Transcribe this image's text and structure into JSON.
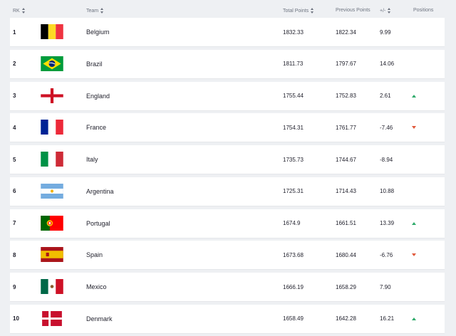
{
  "header": {
    "rank": "RK",
    "team": "Team",
    "total_points": "Total Points",
    "previous_points": "Previous Points",
    "diff": "+/-",
    "positions": "Positions"
  },
  "rows": [
    {
      "rank": "1",
      "team": "Belgium",
      "flag": "belgium-flag",
      "total": "1832.33",
      "previous": "1822.34",
      "diff": "9.99",
      "position": "none"
    },
    {
      "rank": "2",
      "team": "Brazil",
      "flag": "brazil-flag",
      "total": "1811.73",
      "previous": "1797.67",
      "diff": "14.06",
      "position": "none"
    },
    {
      "rank": "3",
      "team": "England",
      "flag": "england-flag",
      "total": "1755.44",
      "previous": "1752.83",
      "diff": "2.61",
      "position": "up"
    },
    {
      "rank": "4",
      "team": "France",
      "flag": "france-flag",
      "total": "1754.31",
      "previous": "1761.77",
      "diff": "-7.46",
      "position": "down"
    },
    {
      "rank": "5",
      "team": "Italy",
      "flag": "italy-flag",
      "total": "1735.73",
      "previous": "1744.67",
      "diff": "-8.94",
      "position": "none"
    },
    {
      "rank": "6",
      "team": "Argentina",
      "flag": "argentina-flag",
      "total": "1725.31",
      "previous": "1714.43",
      "diff": "10.88",
      "position": "none"
    },
    {
      "rank": "7",
      "team": "Portugal",
      "flag": "portugal-flag",
      "total": "1674.9",
      "previous": "1661.51",
      "diff": "13.39",
      "position": "up"
    },
    {
      "rank": "8",
      "team": "Spain",
      "flag": "spain-flag",
      "total": "1673.68",
      "previous": "1680.44",
      "diff": "-6.76",
      "position": "down"
    },
    {
      "rank": "9",
      "team": "Mexico",
      "flag": "mexico-flag",
      "total": "1666.19",
      "previous": "1658.29",
      "diff": "7.90",
      "position": "none"
    },
    {
      "rank": "10",
      "team": "Denmark",
      "flag": "denmark-flag",
      "total": "1658.49",
      "previous": "1642.28",
      "diff": "16.21",
      "position": "up"
    }
  ],
  "colors": {
    "up_arrow": "#2eaa6a",
    "down_arrow": "#e0583a",
    "header_text": "#6e7480",
    "background": "#eef0f3"
  }
}
